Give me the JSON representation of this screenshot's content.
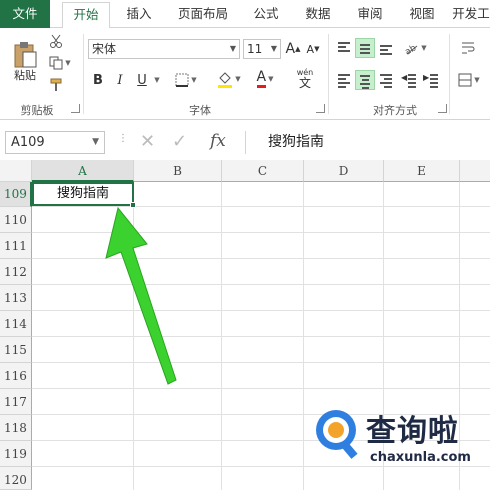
{
  "tabs": [
    "文件",
    "开始",
    "插入",
    "页面布局",
    "公式",
    "数据",
    "审阅",
    "视图",
    "开发工"
  ],
  "ribbon": {
    "clipboard": {
      "paste_label": "粘贴",
      "group_label": "剪贴板"
    },
    "font": {
      "name": "宋体",
      "size": "11",
      "bold": "B",
      "italic": "I",
      "underline": "U",
      "font_color": "A",
      "phonetic": "wén",
      "phonetic_char": "文",
      "grow": "A",
      "shrink": "A",
      "group_label": "字体"
    },
    "alignment": {
      "group_label": "对齐方式"
    }
  },
  "formula_bar": {
    "name_box": "A109",
    "fx_label": "fx",
    "cancel": "✕",
    "enter": "✓",
    "content": "搜狗指南"
  },
  "grid": {
    "columns": [
      "A",
      "B",
      "C",
      "D",
      "E"
    ],
    "rows": [
      "109",
      "110",
      "111",
      "112",
      "113",
      "114",
      "115",
      "116",
      "117",
      "118",
      "119",
      "120"
    ],
    "active_cell_value": "搜狗指南"
  },
  "watermark": {
    "title": "查询啦",
    "url": "chaxunla.com"
  },
  "colors": {
    "accent": "#217346",
    "arrow": "#3bd12f",
    "header_bg": "#f3f3f3"
  }
}
